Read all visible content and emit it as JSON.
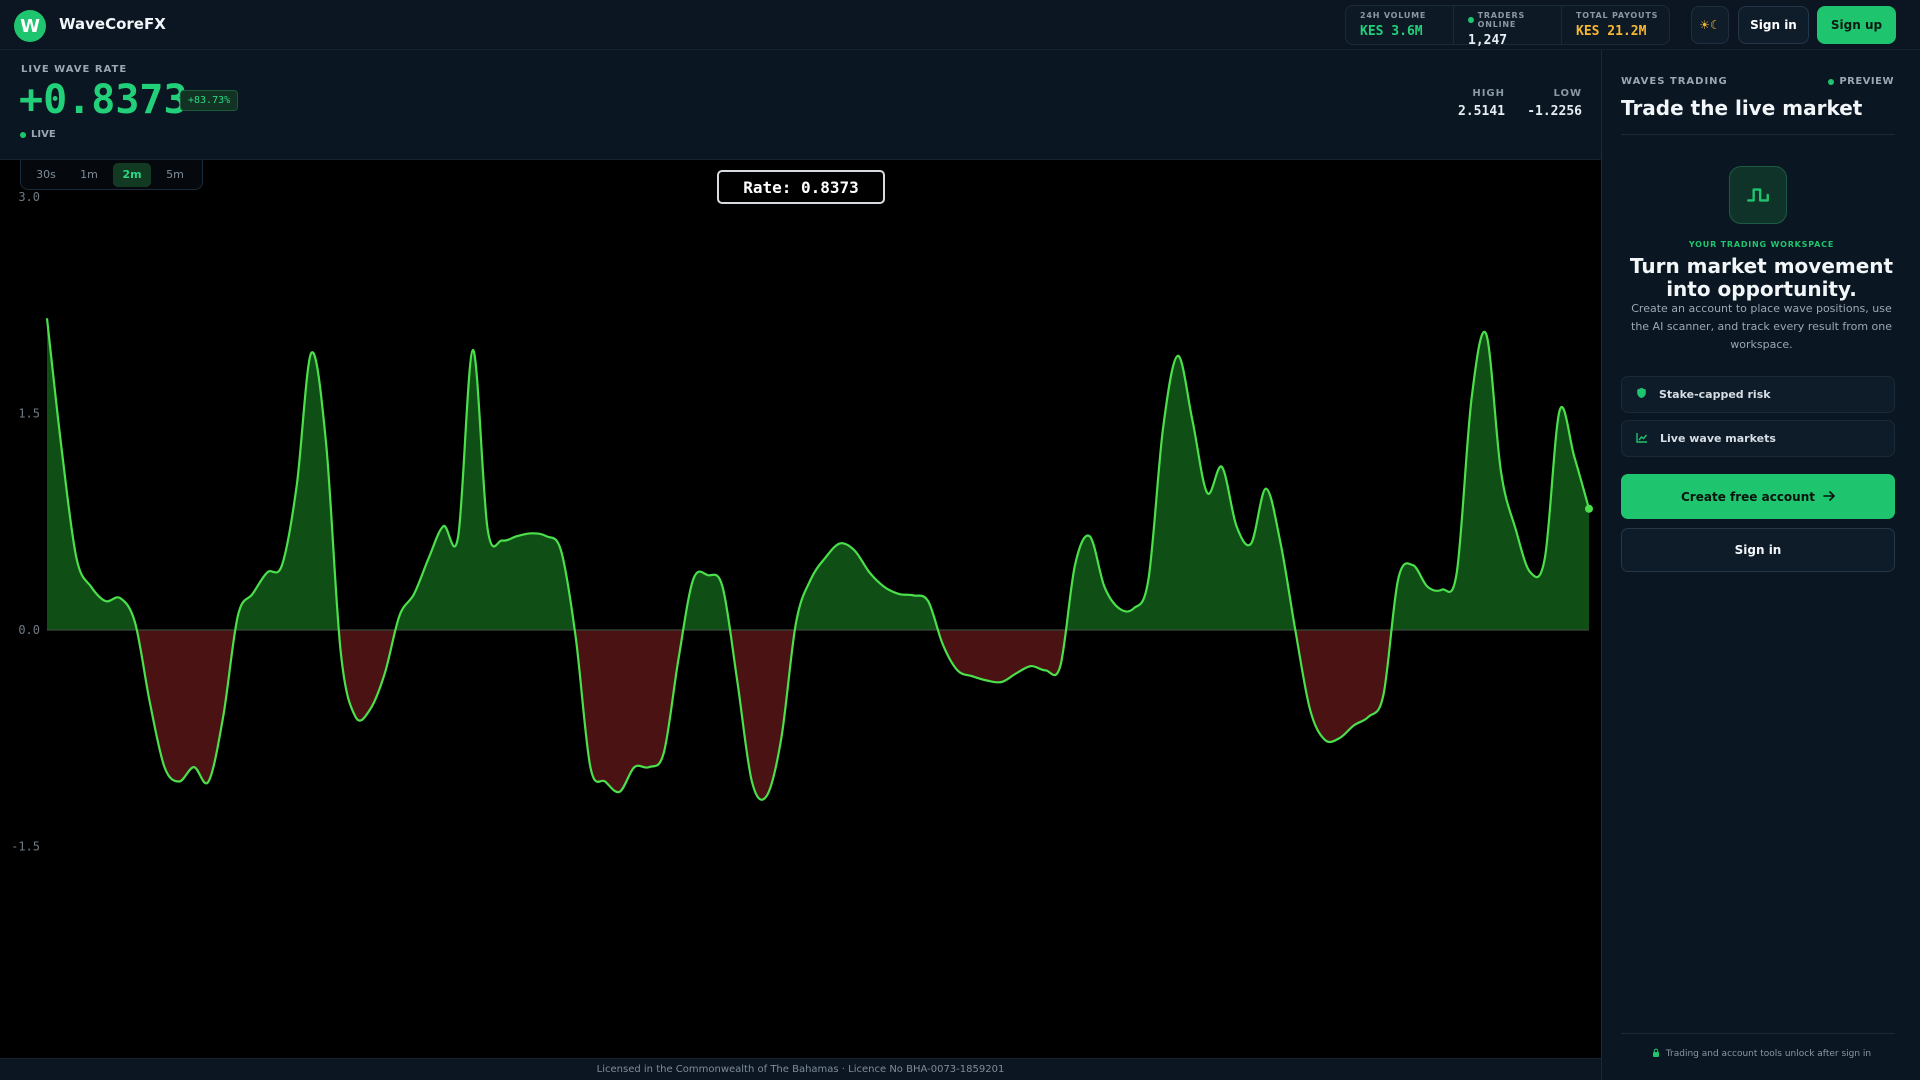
{
  "brand": {
    "logo_letter": "W",
    "name": "WaveCoreFX"
  },
  "topbar": {
    "stats": [
      {
        "label": "24H VOLUME",
        "value": "KES 3.6M",
        "color": "#22d07a",
        "dot": false
      },
      {
        "label": "TRADERS ONLINE",
        "value": "1,247",
        "color": "#e6edf3",
        "dot": true
      },
      {
        "label": "TOTAL PAYOUTS",
        "value": "KES 21.2M",
        "color": "#f5b731",
        "dot": false
      }
    ],
    "theme_toggle": "☀☾",
    "sign_in": "Sign in",
    "sign_up": "Sign up"
  },
  "rate": {
    "label": "LIVE WAVE RATE",
    "value": "+0.8373",
    "change": "+83.73%",
    "live": "LIVE",
    "high_label": "HIGH",
    "high_value": "2.5141",
    "low_label": "LOW",
    "low_value": "-1.2256"
  },
  "timeframes": [
    {
      "label": "30s",
      "active": false
    },
    {
      "label": "1m",
      "active": false
    },
    {
      "label": "2m",
      "active": true
    },
    {
      "label": "5m",
      "active": false
    }
  ],
  "chart_box": "Rate: 0.8373",
  "chart_data": {
    "type": "area",
    "ylim": [
      -3.0,
      3.0
    ],
    "yticks": [
      "3.0",
      "1.5",
      "0.0",
      "-1.5"
    ],
    "ytick_values": [
      3.0,
      1.5,
      0.0,
      -1.5
    ],
    "x": [
      0,
      1,
      2,
      3,
      4,
      5,
      6,
      7,
      8,
      9,
      10,
      11,
      12,
      13,
      14,
      15,
      16,
      17,
      18,
      19,
      20,
      21,
      22,
      23,
      24,
      25,
      26,
      27,
      28,
      29,
      30,
      31,
      32,
      33,
      34,
      35,
      36,
      37,
      38,
      39,
      40,
      41,
      42,
      43,
      44,
      45,
      46,
      47,
      48,
      49,
      50,
      51,
      52,
      53,
      54,
      55,
      56,
      57,
      58,
      59,
      60,
      61,
      62,
      63,
      64,
      65,
      66,
      67,
      68,
      69,
      70,
      71,
      72,
      73,
      74,
      75,
      76,
      77,
      78,
      79,
      80,
      81,
      82,
      83,
      84,
      85,
      86,
      87,
      88,
      89,
      90,
      91,
      92,
      93,
      94,
      95,
      96,
      97,
      98,
      99,
      100,
      101,
      102,
      103,
      104,
      105,
      106,
      107,
      108,
      109,
      110,
      111,
      112,
      113,
      114,
      115,
      116,
      117,
      118,
      119,
      120,
      121,
      122,
      123,
      124,
      125,
      126,
      127,
      128,
      129,
      130,
      131,
      132,
      133,
      134,
      135,
      136,
      137,
      138,
      139,
      140,
      141,
      142,
      143,
      144,
      145,
      146
    ],
    "values": [
      2.16,
      1.25,
      0.5,
      0.3,
      0.2,
      0.22,
      0.05,
      -0.5,
      -0.95,
      -1.05,
      -0.95,
      -1.05,
      -0.6,
      0.1,
      0.25,
      0.4,
      0.45,
      1.0,
      1.92,
      1.3,
      -0.15,
      -0.6,
      -0.55,
      -0.3,
      0.1,
      0.25,
      0.5,
      0.72,
      0.65,
      1.94,
      0.7,
      0.62,
      0.65,
      0.67,
      0.65,
      0.55,
      -0.05,
      -0.95,
      -1.05,
      -1.12,
      -0.95,
      -0.95,
      -0.85,
      -0.2,
      0.35,
      0.38,
      0.3,
      -0.35,
      -1.05,
      -1.15,
      -0.75,
      0.05,
      0.35,
      0.5,
      0.6,
      0.55,
      0.4,
      0.3,
      0.25,
      0.24,
      0.2,
      -0.1,
      -0.28,
      -0.32,
      -0.35,
      -0.36,
      -0.3,
      -0.25,
      -0.28,
      -0.25,
      0.45,
      0.65,
      0.3,
      0.15,
      0.15,
      0.35,
      1.4,
      1.9,
      1.45,
      0.95,
      1.13,
      0.72,
      0.6,
      0.98,
      0.6,
      0.0,
      -0.55,
      -0.76,
      -0.75,
      -0.66,
      -0.6,
      -0.45,
      0.35,
      0.45,
      0.3,
      0.28,
      0.4,
      1.6,
      2.05,
      1.1,
      0.7,
      0.4,
      0.5,
      1.52,
      1.2,
      0.84
    ]
  },
  "footer": "Licensed in the Commonwealth of The Bahamas · Licence No BHA-0073-1859201",
  "panel": {
    "eyebrow": "WAVES TRADING",
    "preview": "PREVIEW",
    "title": "Trade the live market",
    "kicker": "YOUR TRADING WORKSPACE",
    "headline": "Turn market movement into opportunity.",
    "description": "Create an account to place wave positions, use the AI scanner, and track every result from one workspace.",
    "features": [
      "Stake-capped risk",
      "Live wave markets"
    ],
    "create_button": "Create free account",
    "signin_button": "Sign in",
    "footnote": "Trading and account tools unlock after sign in"
  },
  "colors": {
    "accent": "#1fc46e",
    "positive_fill": "#0f4f16",
    "negative_fill": "#4a1212",
    "line": "#4be04b"
  }
}
